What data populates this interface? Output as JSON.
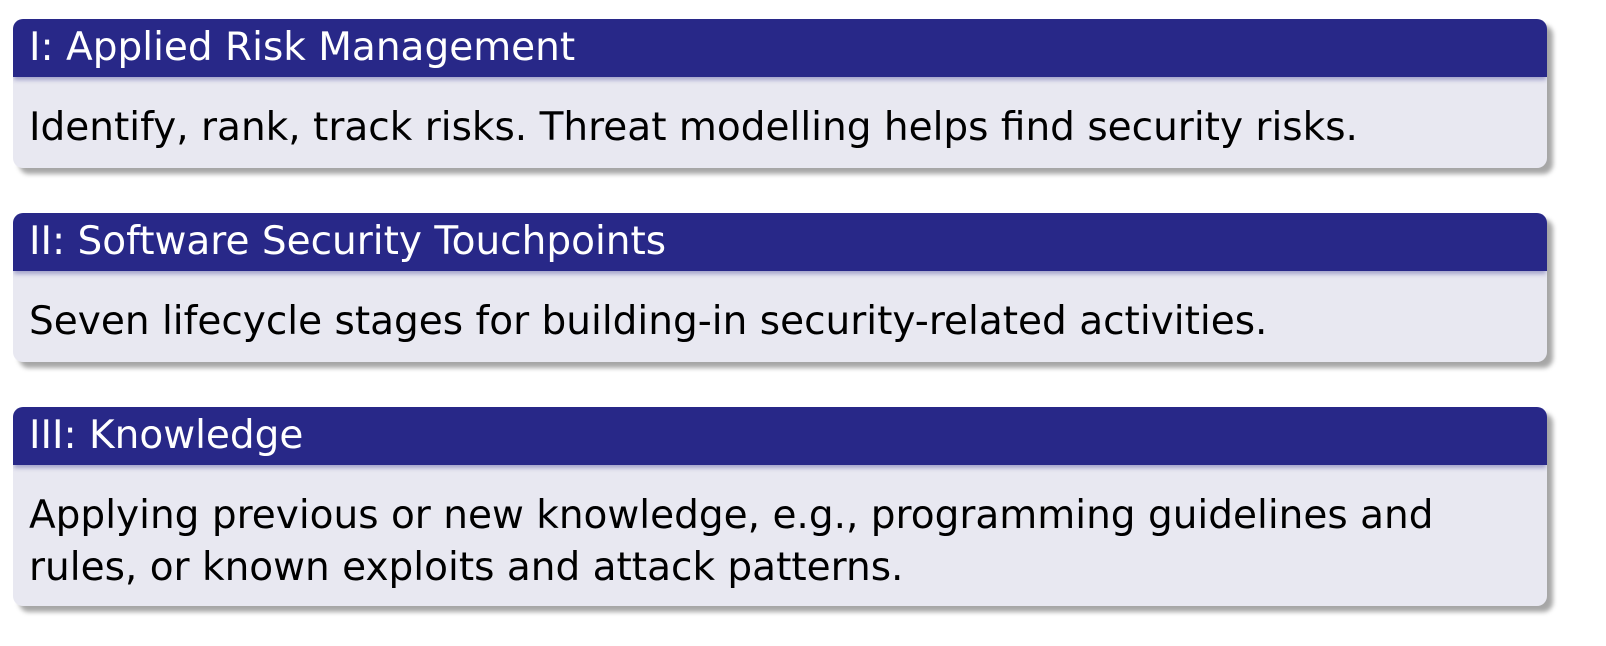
{
  "blocks": [
    {
      "title": "I: Applied Risk Management",
      "body": "Identify, rank, track risks. Threat modelling helps find security risks."
    },
    {
      "title": "II: Software Security Touchpoints",
      "body": "Seven lifecycle stages for building-in security-related activities."
    },
    {
      "title": "III: Knowledge",
      "body": "Applying previous or new knowledge, e.g., programming guidelines and rules, or known exploits and attack patterns."
    }
  ],
  "colors": {
    "title_bar": "#282888",
    "body_background": "#e8e8f1",
    "title_text": "#ffffff",
    "body_text": "#000000"
  }
}
